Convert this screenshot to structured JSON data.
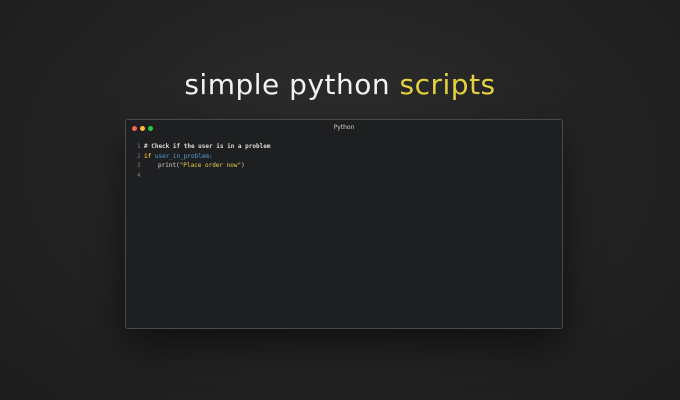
{
  "headline": {
    "text_plain": "simple python",
    "text_accent": "scripts",
    "accent_color": "#e3d23f"
  },
  "window": {
    "title": "Python",
    "traffic_lights": {
      "close_color": "#ff5f57",
      "minimize_color": "#febc2e",
      "maximize_color": "#28c840"
    }
  },
  "code": {
    "language": "python",
    "lines": [
      {
        "number": "1",
        "comment": "# Check if the user is in a problem"
      },
      {
        "number": "2",
        "keyword": "if",
        "condition": "user_in_problem:"
      },
      {
        "number": "3",
        "func": "print(",
        "string": "\"Place order now\"",
        "close": ")"
      },
      {
        "number": "4"
      }
    ]
  }
}
